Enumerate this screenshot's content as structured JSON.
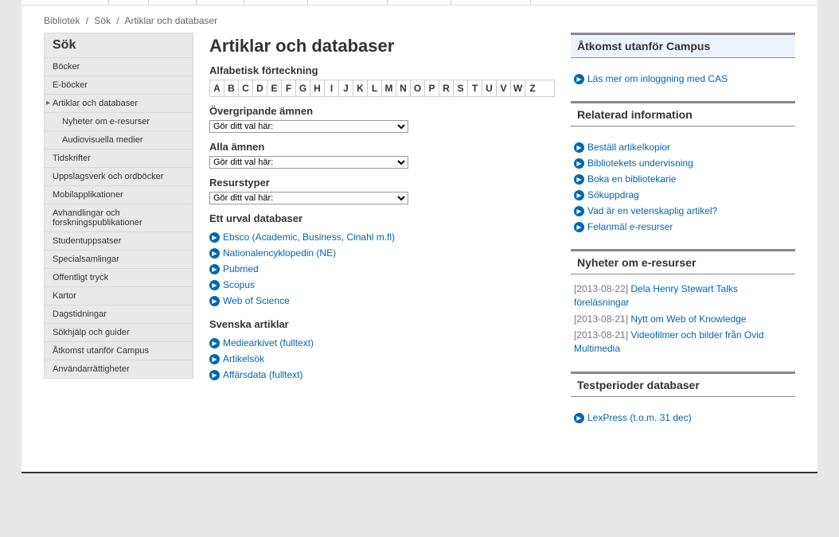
{
  "breadcrumb": {
    "a": "Bibliotek",
    "b": "Sök",
    "c": "Artiklar och databaser"
  },
  "sidenav": {
    "title": "Sök",
    "items": [
      {
        "label": "Böcker"
      },
      {
        "label": "E-böcker"
      },
      {
        "label": "Artiklar och databaser",
        "active": true
      },
      {
        "label": "Nyheter om e-resurser",
        "sub": true
      },
      {
        "label": "Audiovisuella medier",
        "sub": true
      },
      {
        "label": "Tidskrifter"
      },
      {
        "label": "Uppslagsverk och ordböcker"
      },
      {
        "label": "Mobilapplikationer"
      },
      {
        "label": "Avhandlingar och forskningspublikationer"
      },
      {
        "label": "Studentuppsatser"
      },
      {
        "label": "Specialsamlingar"
      },
      {
        "label": "Offentligt tryck"
      },
      {
        "label": "Kartor"
      },
      {
        "label": "Dagstidningar"
      },
      {
        "label": "Sökhjälp och guider"
      },
      {
        "label": "Åtkomst utanför Campus"
      },
      {
        "label": "Användarrättigheter"
      }
    ]
  },
  "main": {
    "title": "Artiklar och databaser",
    "alpha_heading": "Alfabetisk förteckning",
    "alpha": [
      "A",
      "B",
      "C",
      "D",
      "E",
      "F",
      "G",
      "H",
      "I",
      "J",
      "K",
      "L",
      "M",
      "N",
      "O",
      "P",
      "R",
      "S",
      "T",
      "U",
      "V",
      "W",
      "Z"
    ],
    "sec_overgrip": "Övergripande ämnen",
    "sec_amnen": "Alla ämnen",
    "sec_resurs": "Resurstyper",
    "select_placeholder": "Gör ditt val här:",
    "sec_urval": "Ett urval databaser",
    "urval": [
      "Ebsco (Academic, Business, Cinahl m.fl)",
      "Nationalencyklopedin (NE)",
      "Pubmed",
      "Scopus",
      "Web of Science"
    ],
    "sec_svenska": "Svenska artiklar",
    "svenska": [
      "Mediearkivet (fulltext)",
      "Artikelsök",
      "Affärsdata (fulltext)"
    ]
  },
  "right": {
    "box1_title": "Åtkomst utanför Campus",
    "box1_link": "Läs mer om inloggning med CAS",
    "box2_title": "Relaterad information",
    "box2_links": [
      "Beställ artikelkopior",
      "Bibliotekets undervisning",
      "Boka en bibliotekarie",
      "Sökuppdrag",
      "Vad är en vetenskaplig artikel?",
      "Felanmäl e-resurser"
    ],
    "box3_title": "Nyheter om e-resurser",
    "box3_news": [
      {
        "date": "[2013-08-22]",
        "text": "Dela Henry Stewart Talks föreläsningar"
      },
      {
        "date": "[2013-08-21]",
        "text": "Nytt om Web of Knowledge"
      },
      {
        "date": "[2013-08-21]",
        "text": "Videofilmer och bilder från Ovid Multimedia"
      }
    ],
    "box4_title": "Testperioder databaser",
    "box4_links": [
      "LexPress (t.o.m. 31 dec)"
    ]
  }
}
